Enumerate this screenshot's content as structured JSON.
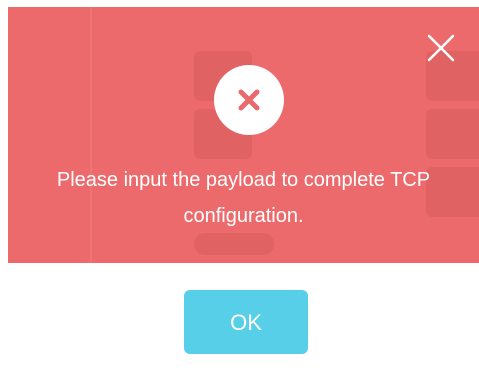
{
  "dialog": {
    "type": "error",
    "message": "Please input the payload to complete TCP configuration.",
    "ok_label": "OK",
    "close_icon": "close-icon",
    "status_icon": "error-x-icon",
    "colors": {
      "header": "#ec6a6c",
      "ok_button": "#58cfe8",
      "icon_mark": "#ea6a6c"
    }
  }
}
